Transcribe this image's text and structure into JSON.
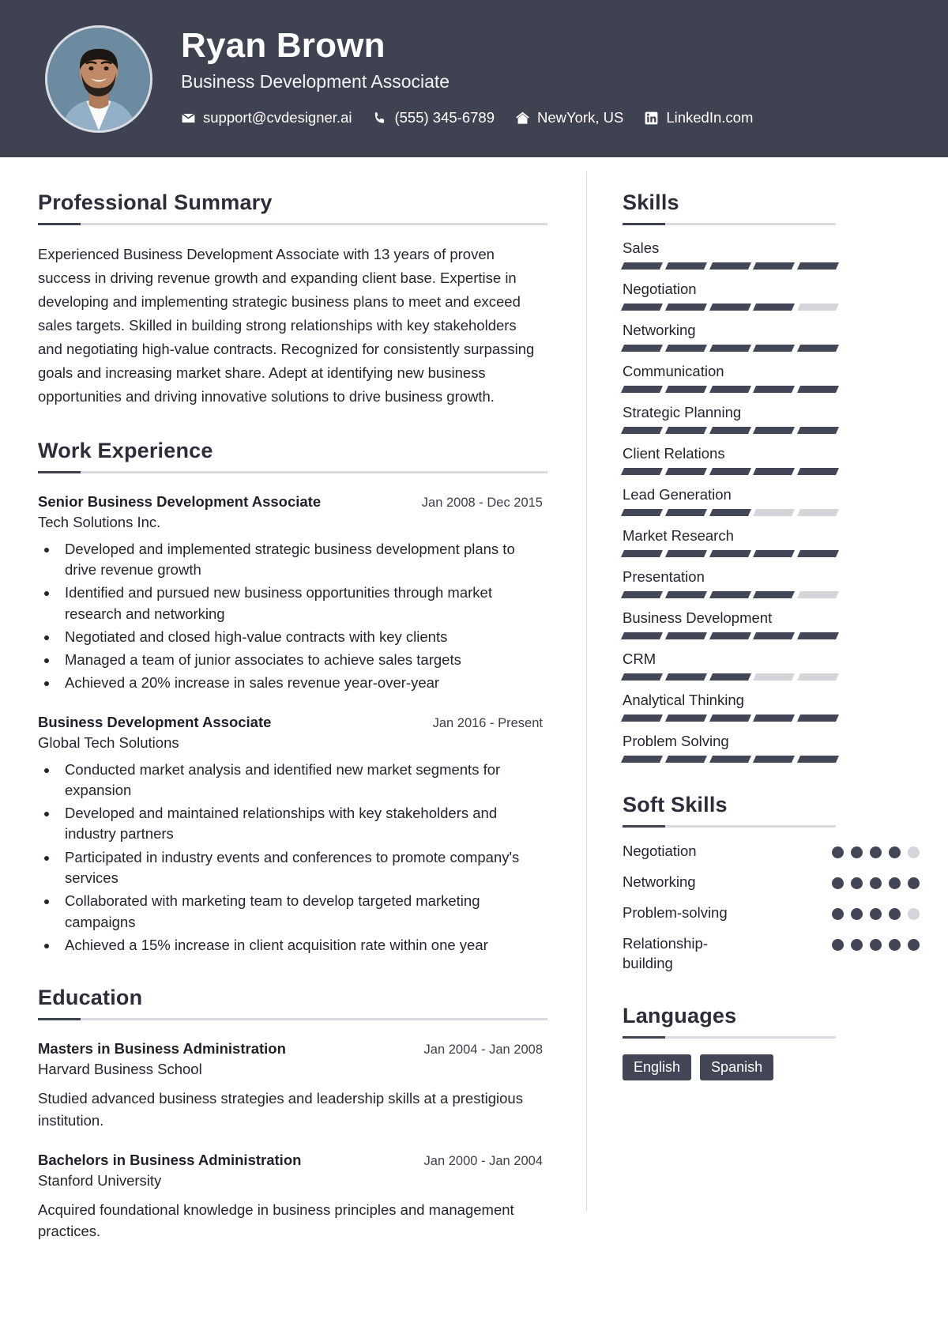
{
  "header": {
    "name": "Ryan Brown",
    "role": "Business Development Associate",
    "avatar_alt": "profile-photo",
    "contacts": [
      {
        "icon": "envelope-icon",
        "text": "support@cvdesigner.ai"
      },
      {
        "icon": "phone-icon",
        "text": "(555) 345-6789"
      },
      {
        "icon": "home-icon",
        "text": "NewYork, US"
      },
      {
        "icon": "linkedin-icon",
        "text": "LinkedIn.com"
      }
    ]
  },
  "summary": {
    "title": "Professional Summary",
    "text": "Experienced Business Development Associate with 13 years of proven success in driving revenue growth and expanding client base. Expertise in developing and implementing strategic business plans to meet and exceed sales targets. Skilled in building strong relationships with key stakeholders and negotiating high-value contracts. Recognized for consistently surpassing goals and increasing market share. Adept at identifying new business opportunities and driving innovative solutions to drive business growth."
  },
  "experience": {
    "title": "Work Experience",
    "items": [
      {
        "title": "Senior Business Development Associate",
        "date": "Jan 2008 - Dec 2015",
        "company": "Tech Solutions Inc.",
        "bullets": [
          "Developed and implemented strategic business development plans to drive revenue growth",
          "Identified and pursued new business opportunities through market research and networking",
          "Negotiated and closed high-value contracts with key clients",
          "Managed a team of junior associates to achieve sales targets",
          "Achieved a 20% increase in sales revenue year-over-year"
        ]
      },
      {
        "title": "Business Development Associate",
        "date": "Jan 2016 - Present",
        "company": "Global Tech Solutions",
        "bullets": [
          "Conducted market analysis and identified new market segments for expansion",
          "Developed and maintained relationships with key stakeholders and industry partners",
          "Participated in industry events and conferences to promote company's services",
          "Collaborated with marketing team to develop targeted marketing campaigns",
          "Achieved a 15% increase in client acquisition rate within one year"
        ]
      }
    ]
  },
  "education": {
    "title": "Education",
    "items": [
      {
        "title": "Masters in Business Administration",
        "date": "Jan 2004 - Jan 2008",
        "school": "Harvard Business School",
        "description": "Studied advanced business strategies and leadership skills at a prestigious institution."
      },
      {
        "title": "Bachelors in Business Administration",
        "date": "Jan 2000 - Jan 2004",
        "school": "Stanford University",
        "description": "Acquired foundational knowledge in business principles and management practices."
      }
    ]
  },
  "skills": {
    "title": "Skills",
    "max_level": 5,
    "items": [
      {
        "name": "Sales",
        "level": 5
      },
      {
        "name": "Negotiation",
        "level": 4
      },
      {
        "name": "Networking",
        "level": 5
      },
      {
        "name": "Communication",
        "level": 5
      },
      {
        "name": "Strategic Planning",
        "level": 5
      },
      {
        "name": "Client Relations",
        "level": 5
      },
      {
        "name": "Lead Generation",
        "level": 3
      },
      {
        "name": "Market Research",
        "level": 5
      },
      {
        "name": "Presentation",
        "level": 4
      },
      {
        "name": "Business Development",
        "level": 5
      },
      {
        "name": "CRM",
        "level": 3
      },
      {
        "name": "Analytical Thinking",
        "level": 5
      },
      {
        "name": "Problem Solving",
        "level": 5
      }
    ]
  },
  "soft_skills": {
    "title": "Soft Skills",
    "max_level": 5,
    "items": [
      {
        "name": "Negotiation",
        "level": 4
      },
      {
        "name": "Networking",
        "level": 5
      },
      {
        "name": "Problem-solving",
        "level": 4
      },
      {
        "name": "Relationship-building",
        "level": 5
      }
    ]
  },
  "languages": {
    "title": "Languages",
    "items": [
      "English",
      "Spanish"
    ]
  },
  "colors": {
    "header_bg": "#3f4251",
    "accent": "#434657",
    "bar_off": "#d4d5d8",
    "text": "#24262f",
    "rule": "#d9dbe0"
  }
}
